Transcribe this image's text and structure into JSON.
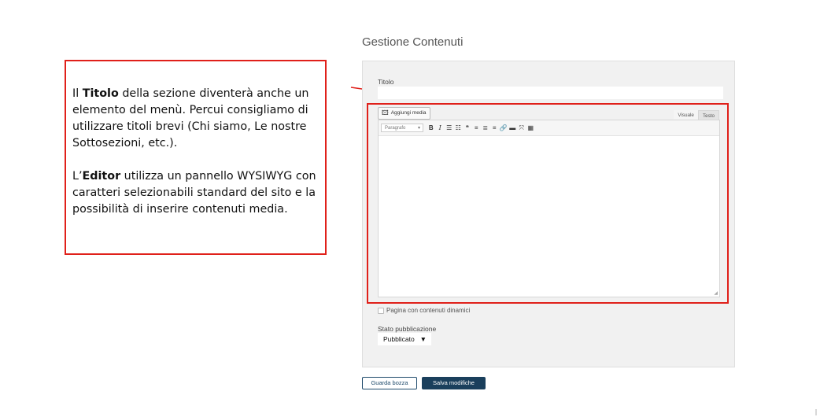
{
  "annotation": {
    "p1_bold": "Titolo",
    "p1_pre": "Il ",
    "p1_post": " della sezione diventerà anche un elemento del menù. Percui consigliamo di utilizzare titoli brevi (Chi siamo, Le nostre Sottosezioni, etc.).",
    "p2_pre": "L’",
    "p2_bold": "Editor",
    "p2_post": " utilizza un pannello WYSIWYG con caratteri selezionabili standard del sito e la possibilità di inserire contenuti media."
  },
  "page": {
    "heading": "Gestione Contenuti"
  },
  "form": {
    "title_label": "Titolo",
    "title_value": "",
    "add_media_label": "Aggiungi media",
    "tabs": {
      "visual": "Visuale",
      "text": "Testo"
    },
    "format_select": "Paragrafo",
    "toolbar_icons": [
      "bold-icon",
      "italic-icon",
      "bullet-list-icon",
      "numbered-list-icon",
      "blockquote-icon",
      "align-left-icon",
      "align-center-icon",
      "align-right-icon",
      "link-icon",
      "read-more-icon",
      "fullscreen-icon",
      "toolbar-toggle-icon"
    ],
    "dynamic_checkbox_label": "Pagina con contenuti dinamici",
    "status_label": "Stato pubblicazione",
    "status_value": "Pubblicato",
    "status_arrow": "▼"
  },
  "actions": {
    "draft_label": "Guarda bozza",
    "save_label": "Salva modifiche"
  },
  "colors": {
    "highlight": "#e0201a",
    "primary_button": "#1a3f5c"
  }
}
